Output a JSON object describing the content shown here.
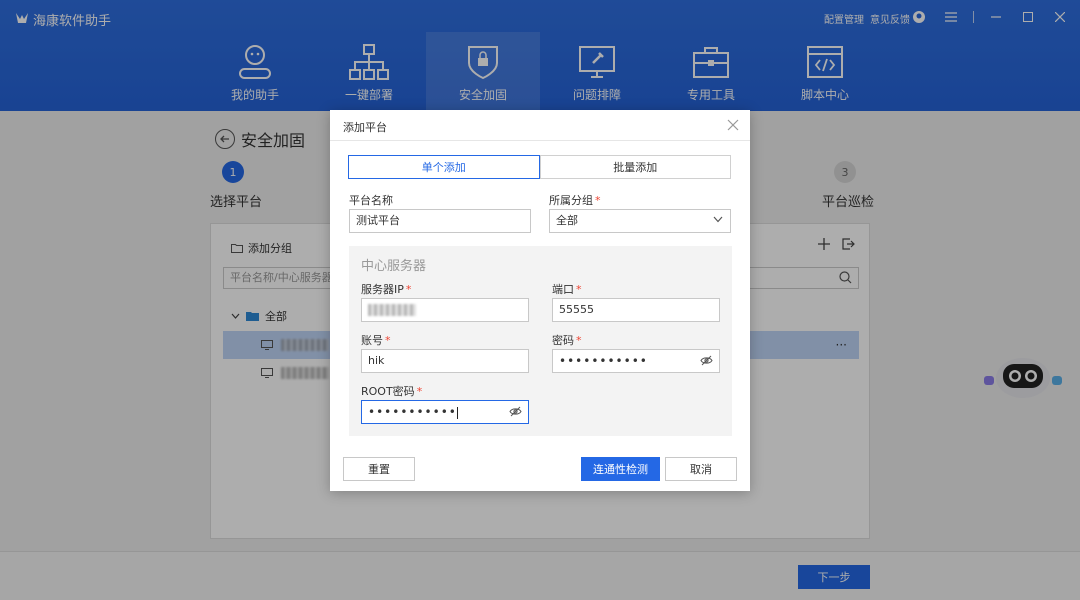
{
  "app": {
    "title": "海康软件助手"
  },
  "top_links": [
    "配置管理",
    "意见反馈"
  ],
  "nav": [
    {
      "label": "我的助手",
      "icon": "assistant-icon"
    },
    {
      "label": "一键部署",
      "icon": "deploy-icon"
    },
    {
      "label": "安全加固",
      "icon": "shield-icon",
      "active": true
    },
    {
      "label": "问题排障",
      "icon": "troubleshoot-icon"
    },
    {
      "label": "专用工具",
      "icon": "toolbox-icon"
    },
    {
      "label": "脚本中心",
      "icon": "script-icon"
    }
  ],
  "page": {
    "title": "安全加固",
    "steps": [
      {
        "num": "1",
        "label": "选择平台"
      },
      {
        "num": "3",
        "label": "平台巡检"
      }
    ],
    "add_group": "添加分组",
    "search_placeholder": "平台名称/中心服务器I",
    "tree_root": "全部",
    "row_more": "···",
    "next_button": "下一步"
  },
  "modal": {
    "title": "添加平台",
    "tabs": [
      "单个添加",
      "批量添加"
    ],
    "platform_name_label": "平台名称",
    "platform_name_value": "测试平台",
    "group_label": "所属分组",
    "group_value": "全部",
    "server_section": "中心服务器",
    "server_ip_label": "服务器IP",
    "port_label": "端口",
    "port_value": "55555",
    "account_label": "账号",
    "account_value": "hik",
    "password_label": "密码",
    "password_value": "•••••••••••",
    "root_password_label": "ROOT密码",
    "root_password_value": "•••••••••••",
    "reset_button": "重置",
    "test_button": "连通性检测",
    "cancel_button": "取消"
  },
  "colors": {
    "primary": "#2468e5",
    "header": "#2a68dc",
    "required": "#ee4433"
  }
}
